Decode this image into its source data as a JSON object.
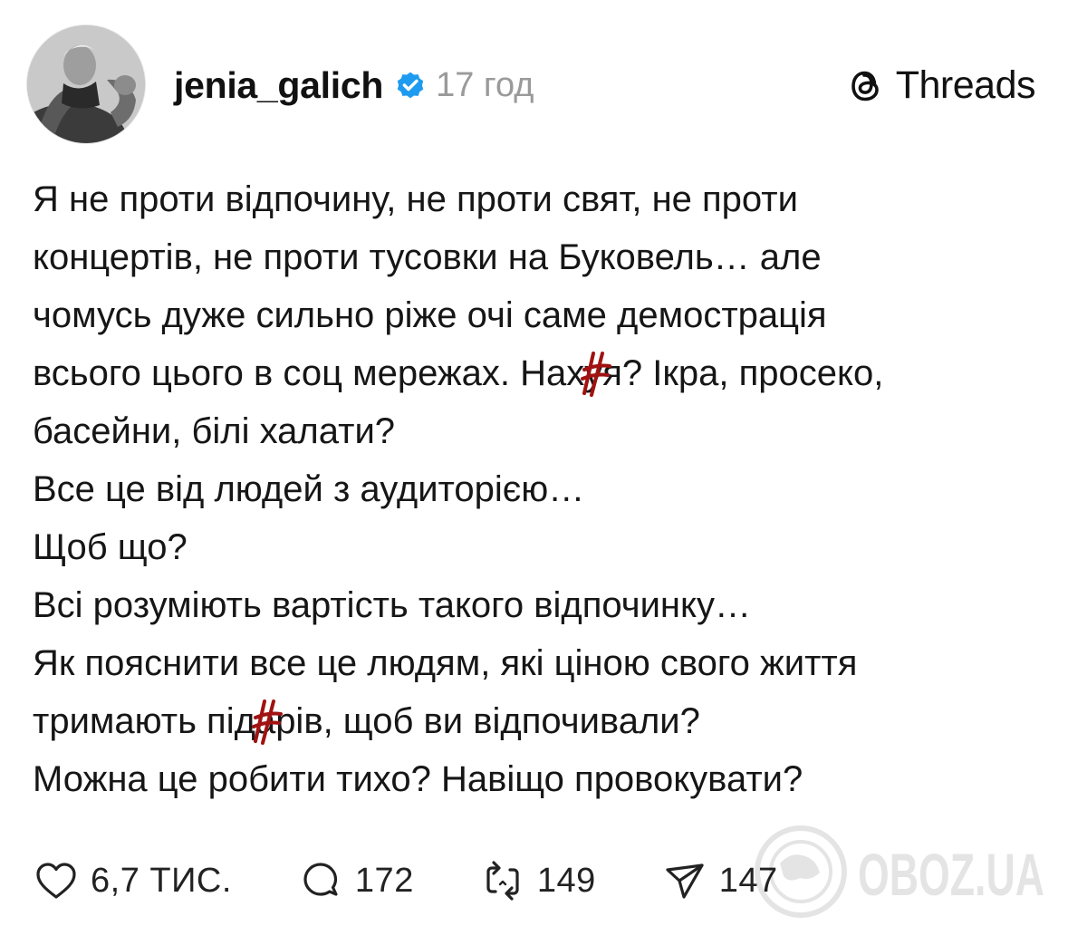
{
  "post": {
    "username": "jenia_galich",
    "time": "17 год",
    "brand": "Threads",
    "paragraphs": [
      [
        "Я не проти відпочину, не проти свят, не проти",
        "концертів, не проти тусовки на Буковель… але",
        "чомусь дуже сильно ріже очі саме демострація"
      ],
      [
        "Все це від людей з аудиторією…"
      ],
      [
        "Щоб що?"
      ],
      [
        "Всі розуміють вартість такого відпочинку…"
      ],
      [
        "Як пояснити все це людям, які ціною свого життя"
      ],
      [
        "Можна це робити тихо? Навіщо провокувати?"
      ]
    ],
    "line4_before": "всього цього в соц мережах. Нах",
    "line4_censored": "у",
    "line4_after": "я? Ікра, просеко,",
    "line5": "басейни, білі халати?",
    "line10_before": "тримають під",
    "line10_censored": "а",
    "line10_after": "рів, щоб ви відпочивали?",
    "actions": {
      "likes": "6,7 ТИС.",
      "comments": "172",
      "reposts": "149",
      "shares": "147"
    },
    "watermark": "OBOZ.UA",
    "colors": {
      "verified": "#1d9bf0",
      "censor": "#a11212",
      "muted": "#9a9a9a"
    },
    "icons": [
      "verified-badge-icon",
      "threads-logo-icon",
      "heart-icon",
      "comment-icon",
      "repost-icon",
      "share-icon"
    ]
  }
}
